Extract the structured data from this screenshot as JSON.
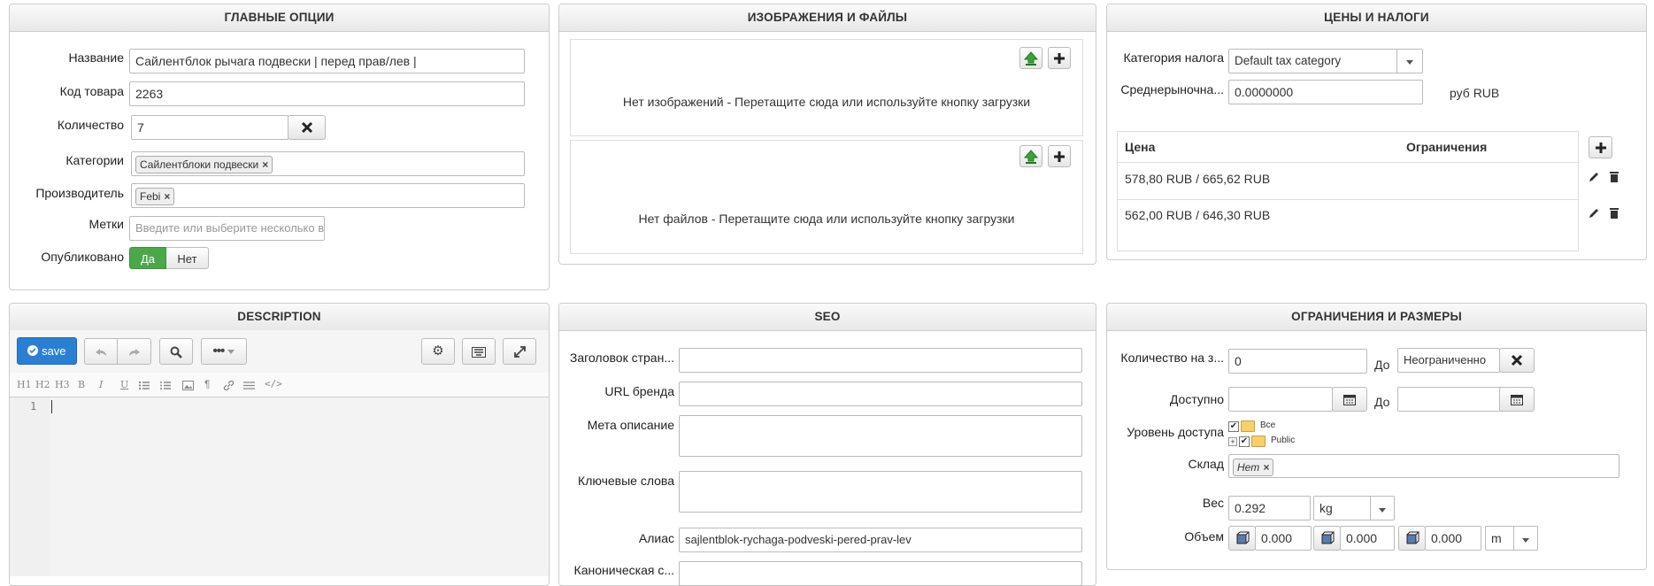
{
  "main": {
    "title": "ГЛАВНЫЕ ОПЦИИ",
    "name_label": "Название",
    "name_value": "Сайлентблок рычага подвески | перед прав/лев |",
    "sku_label": "Код товара",
    "sku_value": "2263",
    "qty_label": "Количество",
    "qty_value": "7",
    "cat_label": "Категории",
    "cat_tag": "Сайлентблоки подвески",
    "mfr_label": "Производитель",
    "mfr_tag": "Febi",
    "tags_label": "Метки",
    "tags_placeholder": "Введите или выберите несколько в",
    "pub_label": "Опубликовано",
    "pub_yes": "Да",
    "pub_no": "Нет"
  },
  "images": {
    "title": "ИЗОБРАЖЕНИЯ И ФАЙЛЫ",
    "no_images": "Нет изображений - Перетащите сюда или используйте кнопку загрузки",
    "no_files": "Нет файлов - Перетащите сюда или используйте кнопку загрузки"
  },
  "prices": {
    "title": "ЦЕНЫ И НАЛОГИ",
    "tax_label": "Категория налога",
    "tax_value": "Default tax category",
    "avg_label": "Среднерыночна...",
    "avg_value": "0.0000000",
    "avg_unit": "руб RUB",
    "col_price": "Цена",
    "col_limits": "Ограничения",
    "rows": [
      {
        "price": "578,80 RUB / 665,62 RUB"
      },
      {
        "price": "562,00 RUB / 646,30 RUB"
      }
    ]
  },
  "description": {
    "title": "DESCRIPTION",
    "save_label": "save",
    "format_buttons": [
      "H1",
      "H2",
      "H3",
      "B",
      "I",
      "U"
    ],
    "line_number": "1"
  },
  "seo": {
    "title": "SEO",
    "page_title_label": "Заголовок стран...",
    "brand_url_label": "URL бренда",
    "meta_desc_label": "Мета описание",
    "keywords_label": "Ключевые слова",
    "alias_label": "Алиас",
    "alias_value": "sajlentblok-rychaga-podveski-pered-prav-lev",
    "canonical_label": "Каноническая с..."
  },
  "limits": {
    "title": "ОГРАНИЧЕНИЯ И РАЗМЕРЫ",
    "qty_label": "Количество на з...",
    "qty_from": "0",
    "to_label": "До",
    "qty_to": "Неограниченно",
    "avail_label": "Доступно",
    "access_label": "Уровень доступа",
    "access_all": "Все",
    "access_public": "Public",
    "warehouse_label": "Склад",
    "warehouse_tag": "Нет",
    "weight_label": "Вес",
    "weight_value": "0.292",
    "weight_unit": "kg",
    "volume_label": "Объем",
    "vol_x": "0.000",
    "vol_y": "0.000",
    "vol_z": "0.000",
    "vol_unit": "m"
  },
  "colors": {
    "save_blue": "#2a7fd4",
    "publish_green": "#4aa84a",
    "upload_green": "#3aa33a"
  }
}
